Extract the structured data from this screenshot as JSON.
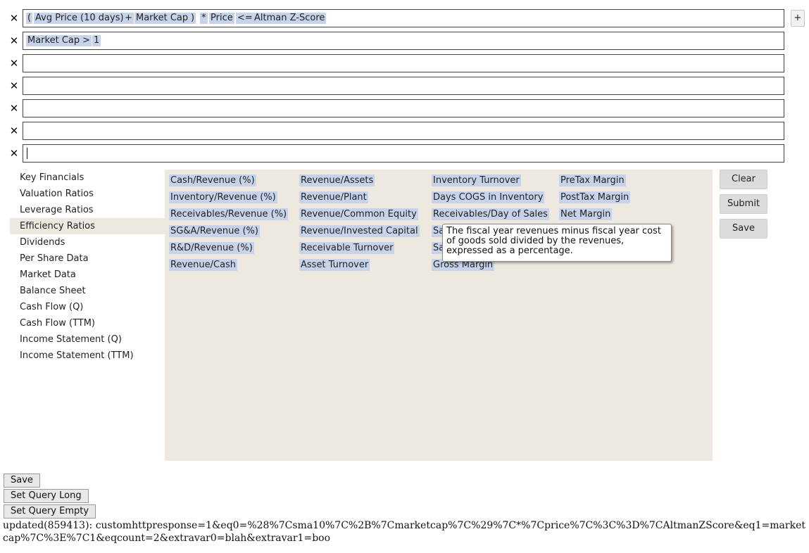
{
  "query_rows": [
    {
      "tokens": [
        "(",
        "Avg Price (10 days)",
        "+",
        "Market Cap",
        ")",
        "*",
        "Price",
        "<=",
        "Altman Z-Score"
      ]
    },
    {
      "tokens": [
        "Market Cap",
        ">",
        "1"
      ]
    },
    {
      "tokens": []
    },
    {
      "tokens": []
    },
    {
      "tokens": []
    },
    {
      "tokens": []
    },
    {
      "tokens": [],
      "focused": true
    }
  ],
  "remove_glyph": "✕",
  "add_row_label": "+",
  "categories": [
    "Key Financials",
    "Valuation Ratios",
    "Leverage Ratios",
    "Efficiency Ratios",
    "Dividends",
    "Per Share Data",
    "Market Data",
    "Balance Sheet",
    "Cash Flow (Q)",
    "Cash Flow (TTM)",
    "Income Statement (Q)",
    "Income Statement (TTM)"
  ],
  "selected_category": "Efficiency Ratios",
  "metrics": {
    "col1": [
      "Cash/Revenue (%)",
      "Inventory/Revenue (%)",
      "Receivables/Revenue (%)",
      "SG&A/Revenue (%)",
      "R&D/Revenue (%)",
      "Revenue/Cash"
    ],
    "col2": [
      "Revenue/Assets",
      "Revenue/Plant",
      "Revenue/Common Equity",
      "Revenue/Invested Capital",
      "Receivable Turnover",
      "Asset Turnover"
    ],
    "col3": [
      "Inventory Turnover",
      "Days COGS in Inventory",
      "Receivables/Day of Sales",
      "Sa",
      "Sa",
      "Gross Margin"
    ],
    "col4": [
      "PreTax Margin",
      "PostTax Margin",
      "Net Margin"
    ]
  },
  "tooltip": "The fiscal year revenues minus fiscal year cost of goods sold divided by the revenues, expressed as a percentage.",
  "side_buttons": {
    "clear": "Clear",
    "submit": "Submit",
    "save": "Save"
  },
  "bottom_buttons": {
    "save": "Save",
    "set_query_long": "Set Query Long",
    "set_query_empty": "Set Query Empty"
  },
  "status_text": "updated(859413): customhttpresponse=1&eq0=%28%7Csma10%7C%2B%7Cmarketcap%7C%29%7C*%7Cprice%7C%3C%3D%7CAltmanZScore&eq1=marketcap%7C%3E%7C1&eqcount=2&extravar0=blah&extravar1=boo"
}
